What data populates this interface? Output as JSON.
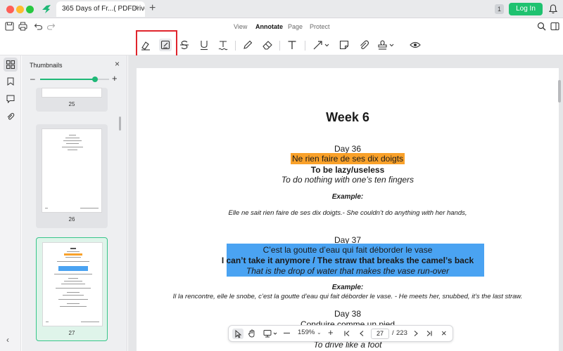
{
  "window": {
    "tab_title": "365 Days of Fr...( PDFDrive ) *",
    "tab_close": "×",
    "tab_add": "+",
    "page_badge": "1",
    "login_label": "Log In"
  },
  "modes": [
    {
      "label": "View",
      "active": false
    },
    {
      "label": "Annotate",
      "active": true
    },
    {
      "label": "Page",
      "active": false
    },
    {
      "label": "Protect",
      "active": false
    }
  ],
  "thumbnails": {
    "title": "Thumbnails",
    "close": "×",
    "zoom_minus": "–",
    "zoom_plus": "+",
    "zoom_level": 0.8,
    "pages": [
      {
        "number": "25",
        "active": false
      },
      {
        "number": "26",
        "active": false
      },
      {
        "number": "27",
        "active": true
      }
    ],
    "collapse": "‹"
  },
  "document": {
    "week_title": "Week 6",
    "entries": [
      {
        "day": "Day 36",
        "french": "Ne rien faire de ses dix doigts",
        "meaning": "To be lazy/useless",
        "literal": "To do nothing with one’s ten fingers",
        "example_label": "Example:",
        "example": "Elle ne sait rien faire de ses dix doigts.- She couldn’t do anything with her hands,"
      },
      {
        "day": "Day 37",
        "french": "C’est la goutte d’eau qui fait déborder le vase",
        "meaning": "I can’t take it anymore / The straw that breaks the camel’s back",
        "literal": "That is the drop of water that makes the vase run-over",
        "example_label": "Example:",
        "example": "Il la rencontre, elle le snobe, c’est la goutte d’eau qui fait déborder le vase. - He meets her, snubbed, it’s the last straw."
      },
      {
        "day": "Day 38",
        "french": "Conduire comme un pied",
        "literal": "To drive like a foot"
      }
    ]
  },
  "navbar": {
    "zoom": "159%",
    "current_page": "27",
    "separator": "/",
    "total_pages": "223",
    "close": "×"
  },
  "colors": {
    "accent_green": "#1fc270",
    "highlight_orange": "#f9a12a",
    "highlight_blue": "#4aa3f2",
    "focus_red": "#e0242c"
  }
}
